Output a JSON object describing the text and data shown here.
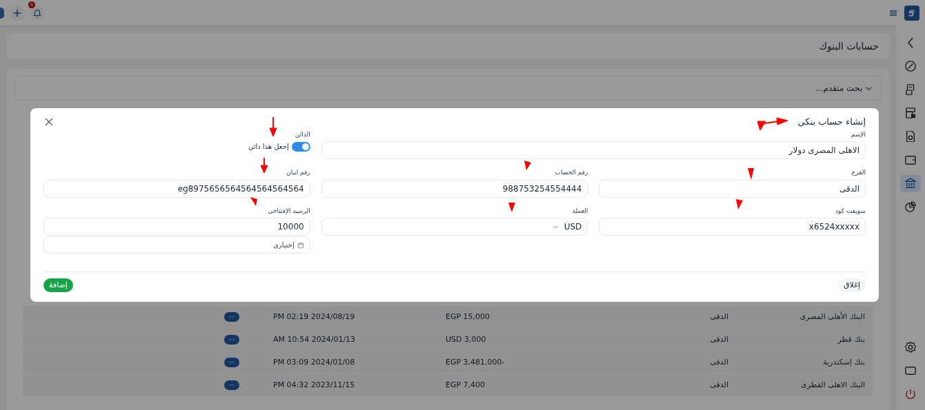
{
  "topbar": {
    "notification_count": "6"
  },
  "sidebar": {
    "items": [
      {
        "selected": false
      },
      {
        "selected": false
      },
      {
        "selected": false
      },
      {
        "selected": false
      },
      {
        "selected": false
      },
      {
        "selected": false
      },
      {
        "selected": true
      },
      {
        "selected": false
      }
    ],
    "bottom_items": [
      {
        "selected": false
      },
      {
        "selected": false
      },
      {
        "selected": false
      }
    ]
  },
  "page_title": "حسابات البنوك",
  "advanced_search": {
    "label": "بحث متقدم...",
    "expanded": false
  },
  "table": {
    "rows": [
      {
        "name": "البنك الأهلى المصرى",
        "branch": "الدقى",
        "balance": "EGP 15,000",
        "date": "PM 02:19 2024/08/19",
        "action": "···"
      },
      {
        "name": "بنك قطر",
        "branch": "الدقى",
        "balance": "USD 3,000",
        "date": "AM 10:54 2024/01/13",
        "action": "···"
      },
      {
        "name": "بنك إسكندرية",
        "branch": "الدقى",
        "balance": "EGP 3,481,000-",
        "date": "PM 03:09 2024/01/08",
        "action": "···"
      },
      {
        "name": "البنك الاهلى القطرى",
        "branch": "الدقى",
        "balance": "EGP 7,400",
        "date": "PM 04:32 2023/11/15",
        "action": "···"
      }
    ]
  },
  "dialog": {
    "title": "إنشاء حساب بنكى",
    "fields": [
      {
        "kind": "text",
        "label": "الإسم",
        "value": "الاهلى المصرى دولار"
      },
      {
        "kind": "toggle",
        "label": "الدائن",
        "text": "إجعل هذا دائن",
        "on": true
      },
      {
        "kind": "text",
        "label": "الفرع",
        "value": "الدقى"
      },
      {
        "kind": "text",
        "label": "رقم الحساب",
        "value": "988753254554444"
      },
      {
        "kind": "text",
        "label": "رقم ايبان",
        "value": "eg8975656564564564564564"
      },
      {
        "kind": "text",
        "label": "سويفت كود",
        "value": "x6524xxxxx"
      },
      {
        "kind": "select",
        "label": "العملة",
        "value": "USD"
      },
      {
        "kind": "text",
        "label": "الرصيد الإفتتاحى",
        "value": "10000"
      },
      {
        "kind": "date",
        "placeholder": "إختيارى"
      }
    ],
    "buttons": [
      {
        "kind": "secondary",
        "label": "إغلاق"
      },
      {
        "kind": "primary",
        "label": "إضافة"
      }
    ]
  }
}
